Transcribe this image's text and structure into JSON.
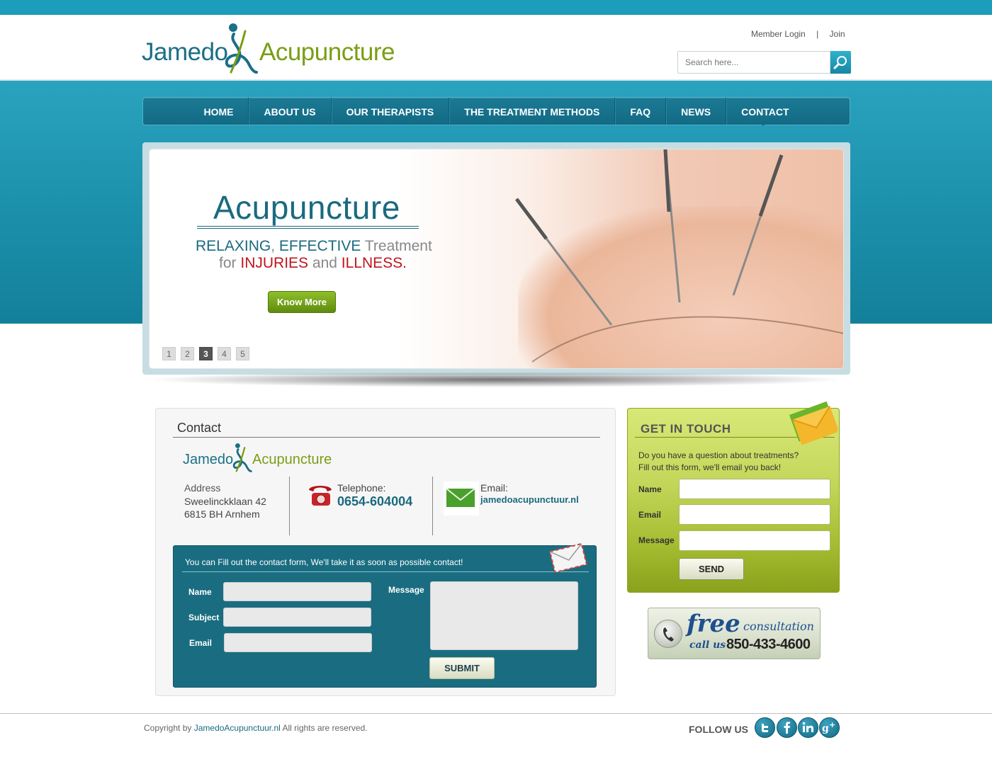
{
  "colors": {
    "brand_teal": "#1a6a7f",
    "brand_green": "#7a9e16",
    "nav_bg": "#136a84",
    "band_teal": "#1c9dbb",
    "alert_red": "#c0141d"
  },
  "header": {
    "logo_part1": "Jamedo",
    "logo_part2": "Acupuncture",
    "member_login": "Member Login",
    "separator": "|",
    "join": "Join",
    "search_placeholder": "Search here...",
    "search_icon": "magnifier-icon"
  },
  "nav": {
    "items": [
      "HOME",
      "ABOUT US",
      "OUR THERAPISTS",
      "THE TREATMENT METHODS",
      "FAQ",
      "NEWS",
      "CONTACT"
    ],
    "active": "CONTACT"
  },
  "slider": {
    "title": "Acupuncture",
    "line1_a": "RELAXING",
    "line1_b": ",",
    "line1_c": "EFFECTIVE",
    "line1_d": "Treatment",
    "line2_a": "for",
    "line2_b": "INJURIES",
    "line2_c": "and",
    "line2_d": "ILLNESS.",
    "button": "Know More",
    "pages": [
      "1",
      "2",
      "3",
      "4",
      "5"
    ],
    "active_page": "3"
  },
  "contact": {
    "title": "Contact",
    "address_label": "Address",
    "address_line1": "Sweelinckklaan 42",
    "address_line2": "6815 BH Arnhem",
    "telephone_label": "Telephone:",
    "telephone": "0654-604004",
    "email_label": "Email:",
    "email": "jamedoacupunctuur.nl",
    "form_intro": "You can Fill out the contact form, We'll take it as soon as possible contact!",
    "name_label": "Name",
    "subject_label": "Subject",
    "email_field_label": "Email",
    "message_label": "Message",
    "submit": "SUBMIT"
  },
  "get_in_touch": {
    "title": "GET IN TOUCH",
    "desc_line1": "Do you have a question about treatments?",
    "desc_line2": "Fill out this form, we'll email you back!",
    "name_label": "Name",
    "email_label": "Email",
    "message_label": "Message",
    "send": "SEND"
  },
  "free_consultation": {
    "free": "free",
    "consultation": "consultation",
    "call_us": "call us",
    "number": "850-433-4600"
  },
  "footer": {
    "copyright_prefix": "Copyright by",
    "copyright_link": "JamedoAcupunctuur.nl",
    "copyright_suffix": "All rights are reserved.",
    "follow_us": "FOLLOW US",
    "social": [
      "twitter-icon",
      "facebook-icon",
      "linkedin-icon",
      "google-plus-icon"
    ]
  }
}
